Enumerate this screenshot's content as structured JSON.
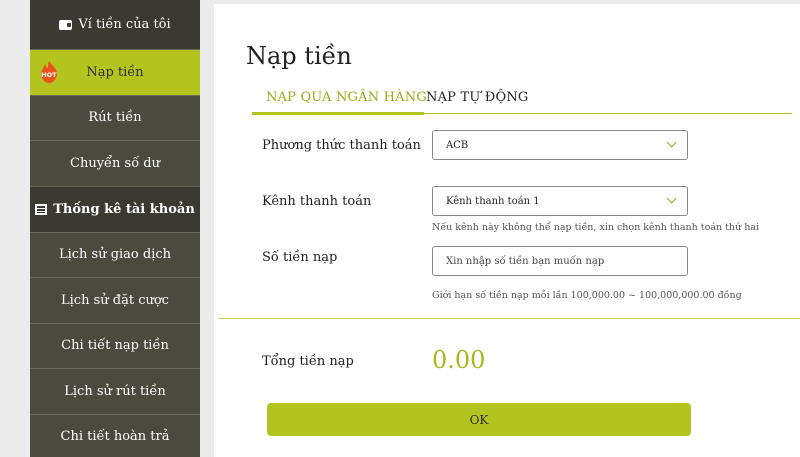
{
  "sidebar": {
    "wallet_header": "Ví tiền của tôi",
    "wallet_items": [
      "Nạp tiền",
      "Rút tiền",
      "Chuyển số dư"
    ],
    "stats_header": "Thống kê tài khoản",
    "stats_items": [
      "Lịch sử giao dịch",
      "Lịch sử đặt cược",
      "Chi tiết nạp tiền",
      "Lịch sử rút tiền",
      "Chi tiết hoàn trả"
    ],
    "hot_badge": "HOT"
  },
  "main": {
    "title": "Nạp tiền",
    "tabs": [
      {
        "label": "NẠP QUA NGÂN HÀNG",
        "active": true
      },
      {
        "label": "NẠP TỰ ĐỘNG",
        "active": false
      }
    ],
    "payment_method_label": "Phương thức thanh toán",
    "payment_method_value": "ACB",
    "channel_label": "Kênh thanh toán",
    "channel_value": "Kênh thanh toán 1",
    "channel_hint": "Nếu kênh này không thể nạp tiền, xin chọn kênh thanh toán thứ hai",
    "amount_label": "Số tiền nạp",
    "amount_placeholder": "Xin nhập số tiền bạn muốn nạp",
    "amount_hint": "Giới hạn số tiền nạp mỗi lần 100,000.00 ~ 100,000,000.00 đồng",
    "total_label": "Tổng tiền nạp",
    "total_value": "0.00",
    "ok_label": "OK"
  },
  "colors": {
    "accent": "#b3c41f",
    "sidebar_bg": "#4a4a3f",
    "sidebar_header_bg": "#3a3a32"
  },
  "icons": [
    "wallet-icon",
    "hot-icon",
    "table-icon",
    "chevron-down-icon"
  ]
}
